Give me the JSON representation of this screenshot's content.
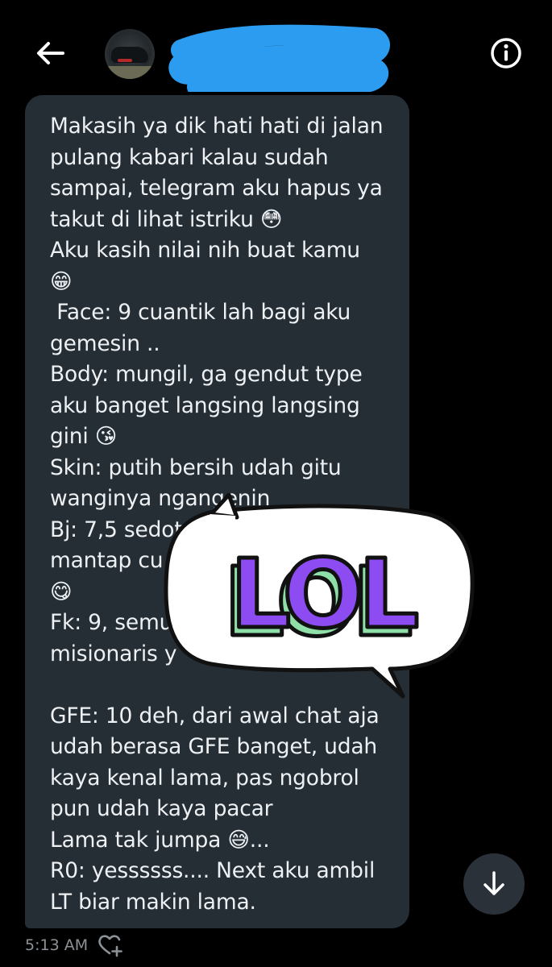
{
  "header": {
    "contact_name": "",
    "icons": {
      "back": "back-arrow-icon",
      "info": "info-icon",
      "avatar": "contact-avatar"
    }
  },
  "message": {
    "lines": [
      "Makasih ya dik hati hati di jalan",
      "pulang kabari kalau sudah",
      "sampai, telegram aku hapus ya",
      "takut di lihat istriku 😳",
      "Aku kasih nilai nih buat kamu",
      "😁",
      " Face: 9 cuantik lah bagi aku",
      "gemesin ..",
      "Body: mungil, ga gendut type",
      "aku banget langsing langsing",
      "gini 😘",
      "Skin: putih bersih udah gitu",
      "wanginya ngangenin",
      "Bj: 7,5 sedotan",
      "mantap cu",
      "😋",
      "Fk: 9, semu",
      "misionaris y",
      "",
      "GFE: 10 deh, dari awal chat aja",
      "udah berasa GFE banget, udah",
      "kaya kenal lama, pas ngobrol",
      "pun udah kaya pacar",
      "Lama tak jumpa 😅...",
      "R0: yessssss.... Next aku ambil",
      "LT biar makin lama."
    ],
    "timestamp": "5:13 AM"
  },
  "sticker": {
    "text": "LOL",
    "colors": {
      "fill": "#8c4cf2",
      "shadow": "#8fe0a8",
      "outline": "#111111",
      "bubble": "#ffffff"
    }
  },
  "colors": {
    "background": "#000000",
    "bubble": "#252d35",
    "text": "#eef1f3",
    "timestamp": "#8b9196",
    "scribble": "#2c9cf0"
  }
}
